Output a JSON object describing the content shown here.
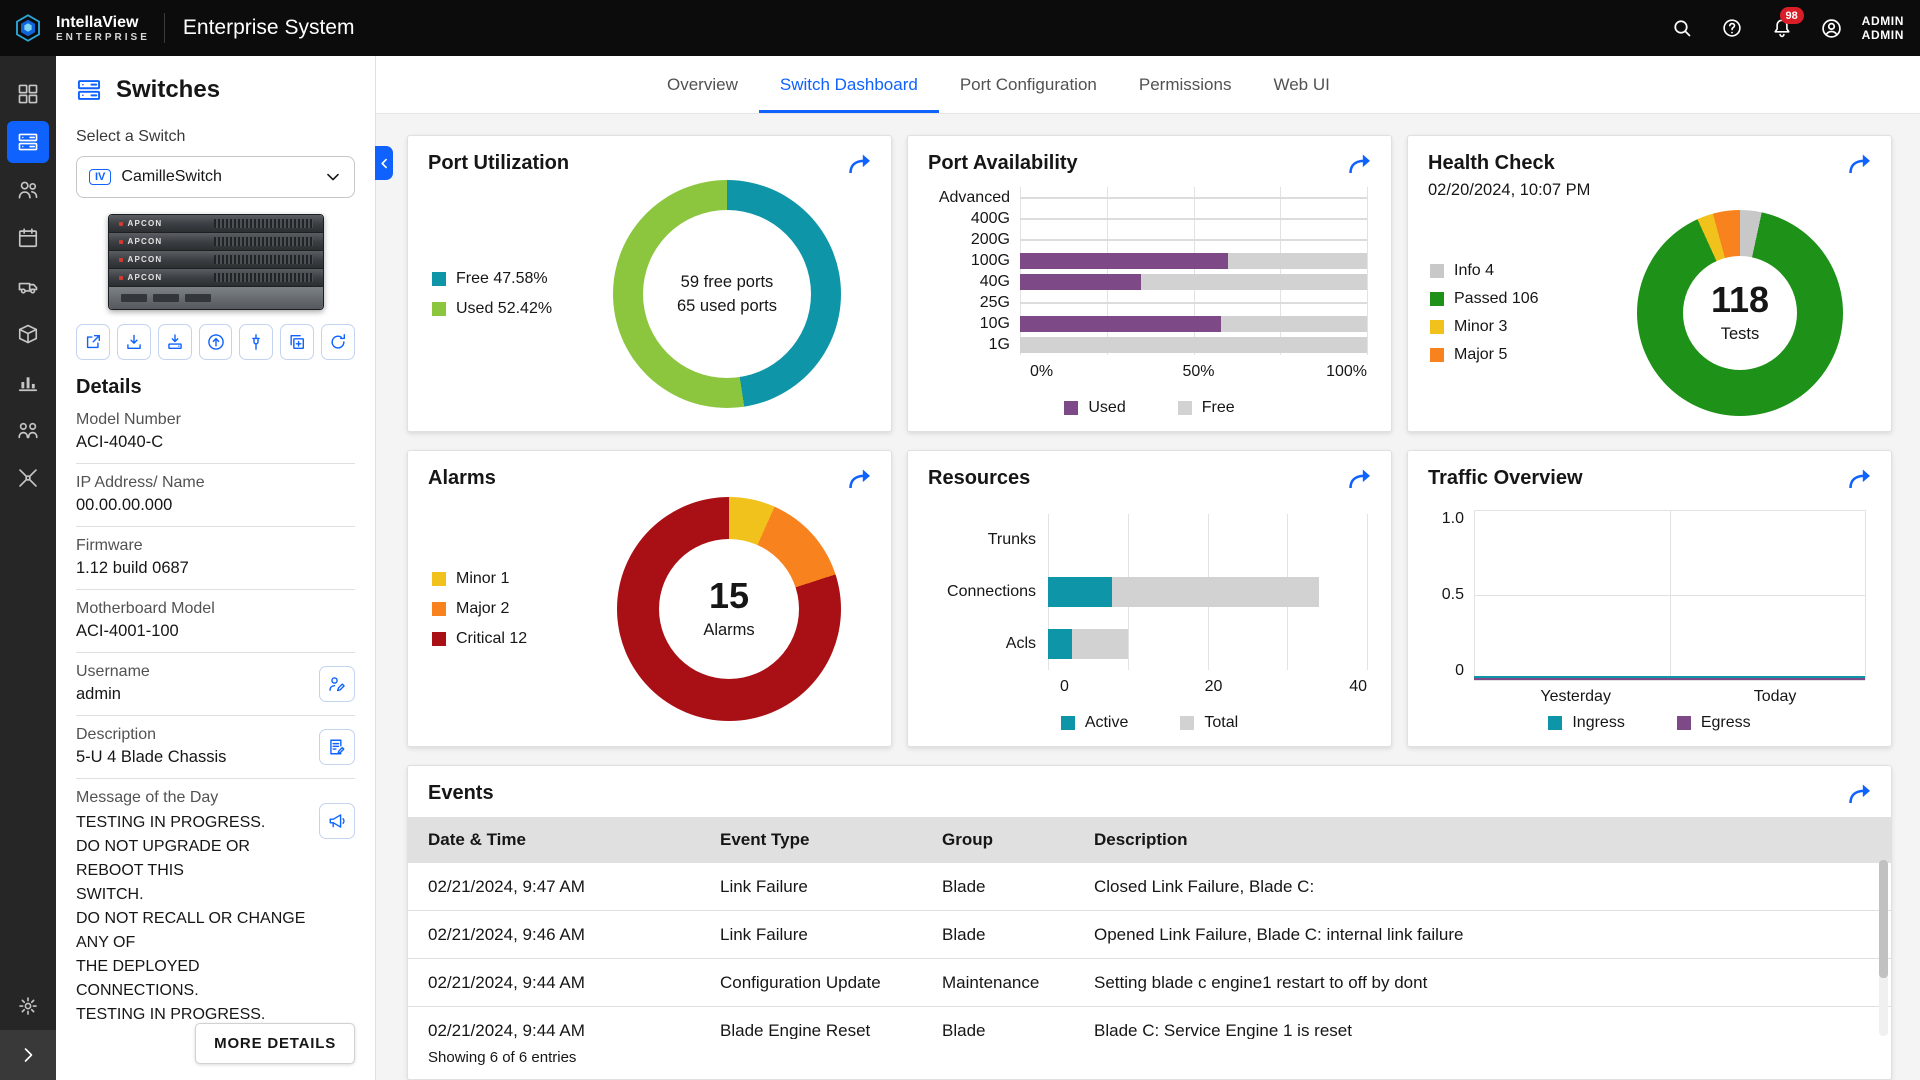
{
  "colors": {
    "accent": "#0f62fe",
    "badge": "#da1e28"
  },
  "topbar": {
    "brand": "IntellaView",
    "brand_sub": "ENTERPRISE",
    "app_title": "Enterprise System",
    "notification_count": "98",
    "user_line1": "ADMIN",
    "user_line2": "ADMIN"
  },
  "rail": {
    "items": [
      {
        "icon": "dashboard",
        "active": false
      },
      {
        "icon": "switches",
        "active": true
      },
      {
        "icon": "users",
        "active": false
      },
      {
        "icon": "calendar",
        "active": false
      },
      {
        "icon": "vehicle",
        "active": false
      },
      {
        "icon": "package",
        "active": false
      },
      {
        "icon": "analytics",
        "active": false
      },
      {
        "icon": "team",
        "active": false
      },
      {
        "icon": "tools",
        "active": false
      }
    ],
    "bottom": [
      {
        "icon": "settings"
      },
      {
        "icon": "chevron-right"
      }
    ]
  },
  "panel": {
    "title": "Switches",
    "select_label": "Select a Switch",
    "switch_tag": "IV",
    "switch_name": "CamilleSwitch",
    "device_brand": "APCON",
    "toolbar": [
      {
        "icon": "launch",
        "name": "open-external"
      },
      {
        "icon": "import",
        "name": "import-config"
      },
      {
        "icon": "install",
        "name": "install-firmware"
      },
      {
        "icon": "upload",
        "name": "upload"
      },
      {
        "icon": "probe",
        "name": "probe"
      },
      {
        "icon": "duplicate",
        "name": "duplicate"
      },
      {
        "icon": "restart",
        "name": "restart"
      }
    ],
    "details_title": "Details",
    "fields": [
      {
        "label": "Model Number",
        "value": "ACI-4040-C"
      },
      {
        "label": "IP Address/ Name",
        "value": "00.00.00.000"
      },
      {
        "label": "Firmware",
        "value": "1.12 build 0687"
      },
      {
        "label": "Motherboard Model",
        "value": "ACI-4001-100"
      },
      {
        "label": "Username",
        "value": "admin",
        "action": "edit-user"
      },
      {
        "label": "Description",
        "value": "5-U 4 Blade Chassis",
        "action": "edit-note"
      }
    ],
    "motd": {
      "label": "Message of the Day",
      "lines": [
        "TESTING IN PROGRESS.",
        "DO NOT UPGRADE OR REBOOT THIS",
        "SWITCH.",
        "DO NOT RECALL OR CHANGE ANY OF",
        "THE DEPLOYED CONNECTIONS.",
        "TESTING IN PROGRESS."
      ],
      "action": "announce"
    },
    "more_details_label": "MORE DETAILS"
  },
  "tabs": [
    {
      "label": "Overview",
      "active": false
    },
    {
      "label": "Switch Dashboard",
      "active": true
    },
    {
      "label": "Port Configuration",
      "active": false
    },
    {
      "label": "Permissions",
      "active": false
    },
    {
      "label": "Web UI",
      "active": false
    }
  ],
  "cards": {
    "port_utilization": {
      "title": "Port Utilization",
      "center_line1": "59 free ports",
      "center_line2": "65 used ports"
    },
    "port_availability": {
      "title": "Port Availability"
    },
    "health_check": {
      "title": "Health Check",
      "timestamp": "02/20/2024, 10:07 PM",
      "center_value": "118",
      "center_label": "Tests"
    },
    "alarms": {
      "title": "Alarms",
      "center_value": "15",
      "center_label": "Alarms"
    },
    "resources": {
      "title": "Resources"
    },
    "traffic": {
      "title": "Traffic Overview"
    },
    "events": {
      "title": "Events",
      "columns": [
        "Date & Time",
        "Event Type",
        "Group",
        "Description"
      ],
      "rows": [
        [
          "02/21/2024, 9:47 AM",
          "Link Failure",
          "Blade",
          "Closed Link Failure, Blade C:"
        ],
        [
          "02/21/2024, 9:46 AM",
          "Link Failure",
          "Blade",
          "Opened Link Failure, Blade C: internal link failure"
        ],
        [
          "02/21/2024, 9:44 AM",
          "Configuration Update",
          "Maintenance",
          "Setting blade c engine1 restart to off by dont"
        ],
        [
          "02/21/2024, 9:44 AM",
          "Blade Engine Reset",
          "Blade",
          "Blade C: Service Engine 1 is reset"
        ]
      ],
      "footer": "Showing 6 of 6 entries"
    }
  },
  "chart_data": [
    {
      "id": "port_utilization",
      "type": "pie",
      "title": "Port Utilization",
      "segments": [
        {
          "label": "Free",
          "pct": 47.58,
          "color": "#0f95a8",
          "legend": "Free 47.58%"
        },
        {
          "label": "Used",
          "pct": 52.42,
          "color": "#8cc63f",
          "legend": "Used 52.42%"
        }
      ],
      "center": [
        "59 free ports",
        "65 used ports"
      ]
    },
    {
      "id": "port_availability",
      "type": "bar",
      "orientation": "horizontal",
      "stacked": true,
      "title": "Port Availability",
      "categories": [
        "Advanced",
        "400G",
        "200G",
        "100G",
        "40G",
        "25G",
        "10G",
        "1G"
      ],
      "series": [
        {
          "name": "Used",
          "color": "#7d4a87",
          "values": [
            null,
            null,
            null,
            60,
            35,
            null,
            58,
            0
          ]
        },
        {
          "name": "Free",
          "color": "#d2d2d2",
          "values": [
            null,
            null,
            null,
            40,
            65,
            null,
            42,
            100
          ]
        }
      ],
      "xlim": [
        0,
        100
      ],
      "xticks": [
        "0%",
        "50%",
        "100%"
      ],
      "legend_position": "bottom"
    },
    {
      "id": "health_check",
      "type": "pie",
      "title": "Health Check",
      "total": 118,
      "segments": [
        {
          "label": "Info",
          "value": 4,
          "pct": 3.39,
          "color": "#c8c8c8",
          "legend": "Info 4"
        },
        {
          "label": "Passed",
          "value": 106,
          "pct": 89.83,
          "color": "#1d9118",
          "legend": "Passed 106"
        },
        {
          "label": "Minor",
          "value": 3,
          "pct": 2.54,
          "color": "#f1c21b",
          "legend": "Minor 3"
        },
        {
          "label": "Major",
          "value": 5,
          "pct": 4.24,
          "color": "#f7821e",
          "legend": "Major 5"
        }
      ],
      "center": [
        "118",
        "Tests"
      ]
    },
    {
      "id": "alarms",
      "type": "pie",
      "title": "Alarms",
      "total": 15,
      "segments": [
        {
          "label": "Minor",
          "value": 1,
          "pct": 6.67,
          "color": "#f1c21b",
          "legend": "Minor 1"
        },
        {
          "label": "Major",
          "value": 2,
          "pct": 13.33,
          "color": "#f7821e",
          "legend": "Major 2"
        },
        {
          "label": "Critical",
          "value": 12,
          "pct": 80.0,
          "color": "#a91016",
          "legend": "Critical 12"
        }
      ],
      "center": [
        "15",
        "Alarms"
      ]
    },
    {
      "id": "resources",
      "type": "bar",
      "orientation": "horizontal",
      "stacked": true,
      "title": "Resources",
      "categories": [
        "Trunks",
        "Connections",
        "Acls"
      ],
      "series": [
        {
          "name": "Active",
          "color": "#0f95a8",
          "values": [
            0,
            8,
            3
          ]
        },
        {
          "name": "Total",
          "color": "#d2d2d2",
          "values": [
            0,
            34,
            10
          ]
        }
      ],
      "xlim": [
        0,
        40
      ],
      "xticks": [
        "0",
        "20",
        "40"
      ],
      "legend_position": "bottom"
    },
    {
      "id": "traffic",
      "type": "line",
      "title": "Traffic Overview",
      "x": [
        "Yesterday",
        "Today"
      ],
      "series": [
        {
          "name": "Ingress",
          "color": "#0f95a8",
          "values": [
            0,
            0
          ]
        },
        {
          "name": "Egress",
          "color": "#7d4a87",
          "values": [
            0,
            0
          ]
        }
      ],
      "ylim": [
        0,
        1
      ],
      "yticks": [
        "1.0",
        "0.5",
        "0"
      ],
      "legend_position": "bottom"
    }
  ]
}
